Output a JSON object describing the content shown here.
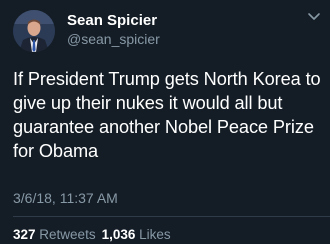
{
  "user": {
    "name": "Sean Spicier",
    "handle": "@sean_spicier"
  },
  "tweet": {
    "text": "If President Trump gets North Korea to\ngive up their nukes it would all but\nguarantee another Nobel Peace Prize\nfor Obama",
    "timestamp": "3/6/18, 11:37 AM"
  },
  "stats": {
    "retweets_count": "327",
    "retweets_label": "Retweets",
    "likes_count": "1,036",
    "likes_label": "Likes"
  },
  "colors": {
    "background": "#141d26",
    "secondary_text": "#8899a6"
  },
  "icons": {
    "menu": "chevron-down-icon"
  }
}
